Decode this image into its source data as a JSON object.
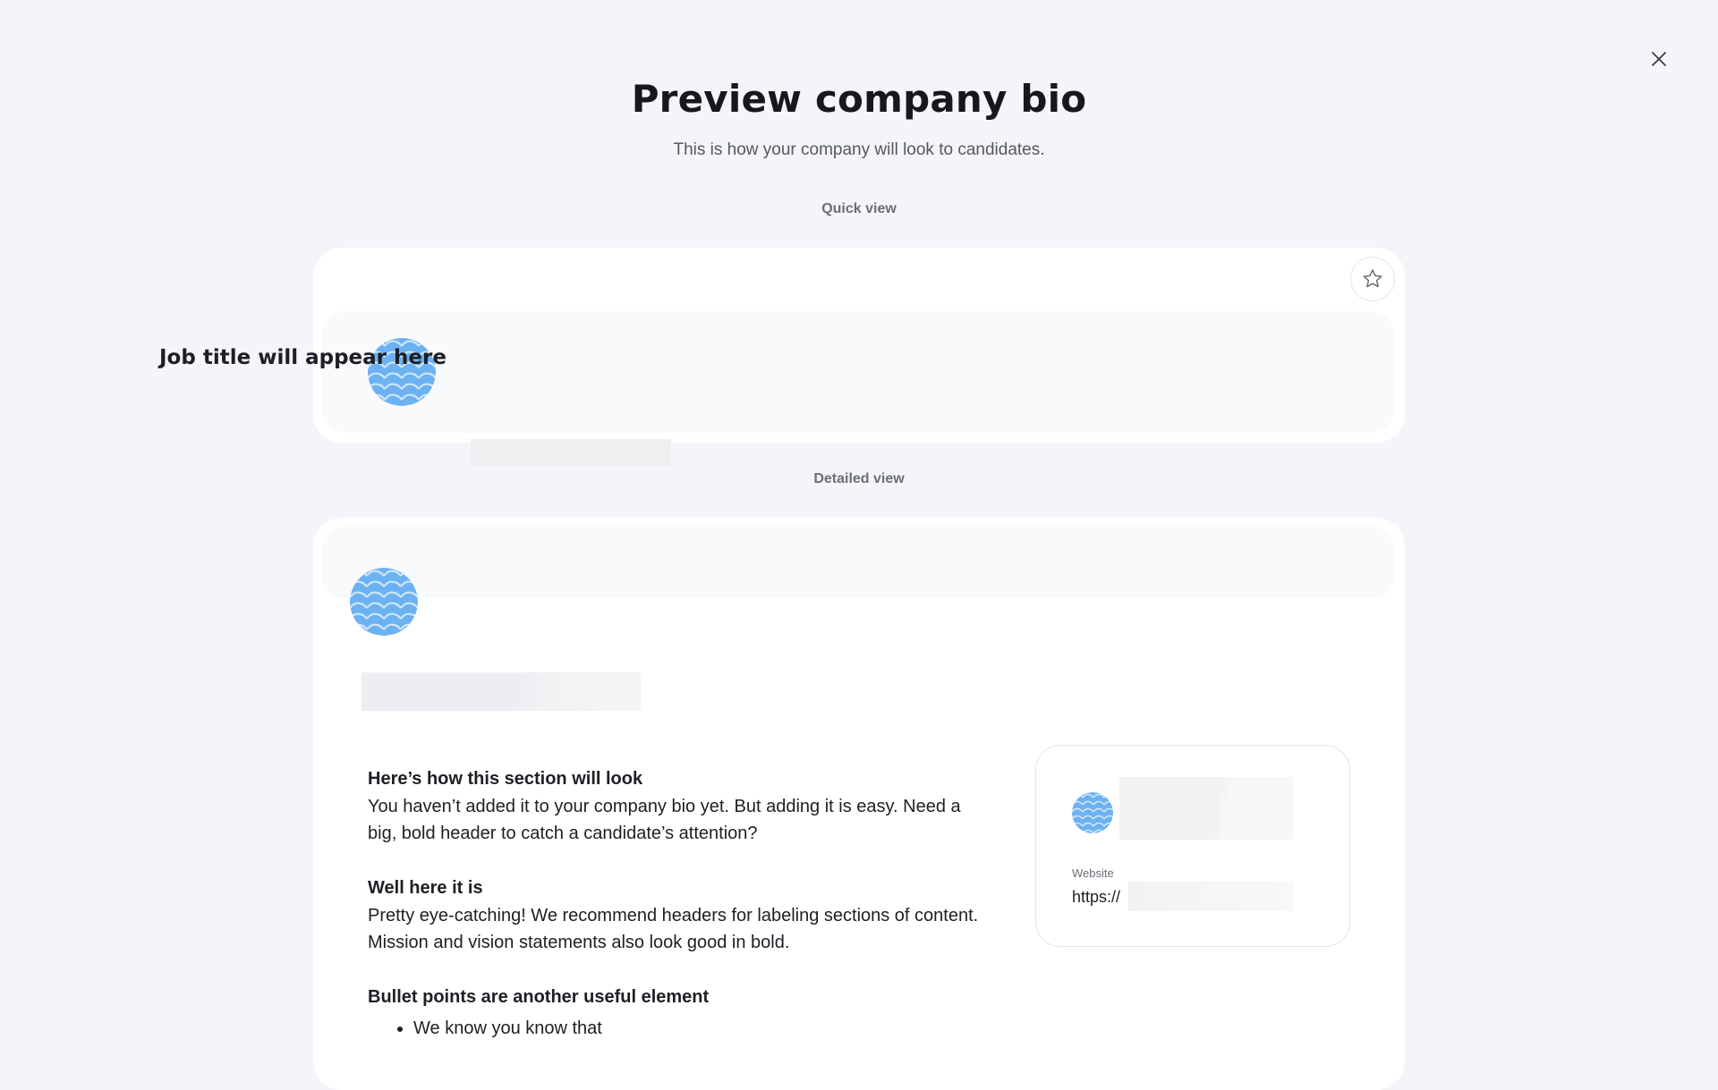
{
  "header": {
    "title": "Preview company bio",
    "subtitle": "This is how your company will look to candidates.",
    "close_icon": "close-icon"
  },
  "quick_view": {
    "label": "Quick view",
    "job_title": "Job title will appear here",
    "favorite_icon": "star-icon"
  },
  "detailed_view": {
    "label": "Detailed view",
    "bio": {
      "heading1": "Here’s how this section will look",
      "paragraph1": "You haven’t added it to your company bio yet. But adding it is easy. Need a big, bold header to catch a candidate’s attention?",
      "heading2": "Well here it is",
      "paragraph2": "Pretty eye-catching! We recommend headers for labeling sections of content. Mission and vision statements also look good in bold.",
      "heading3": "Bullet points are another useful element",
      "bullets": [
        "We know you know that"
      ]
    },
    "info": {
      "website_label": "Website",
      "website_value": "https://"
    }
  },
  "colors": {
    "background": "#f4f5f8",
    "logo_blue": "#6cb1f2",
    "card": "#ffffff"
  }
}
